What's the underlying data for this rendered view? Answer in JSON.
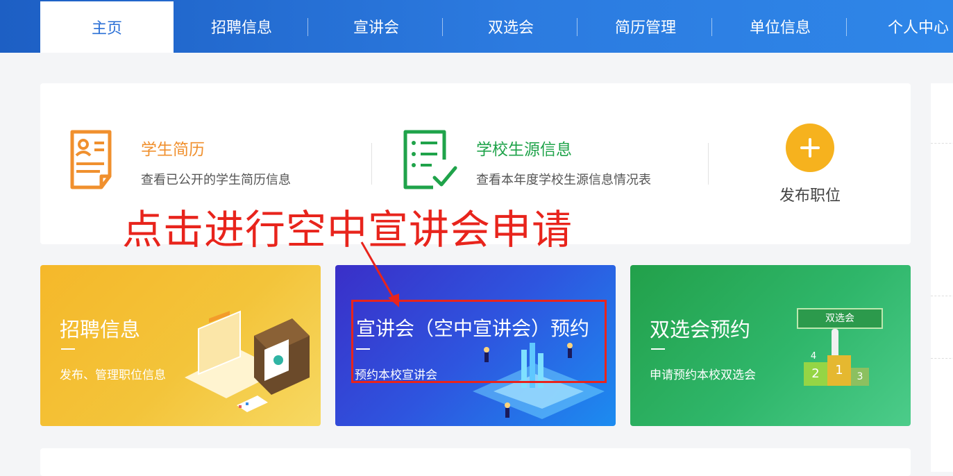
{
  "nav": {
    "tabs": [
      {
        "label": "主页",
        "active": true
      },
      {
        "label": "招聘信息",
        "active": false
      },
      {
        "label": "宣讲会",
        "active": false
      },
      {
        "label": "双选会",
        "active": false
      },
      {
        "label": "简历管理",
        "active": false
      },
      {
        "label": "单位信息",
        "active": false
      },
      {
        "label": "个人中心",
        "active": false
      }
    ]
  },
  "quick": {
    "resume": {
      "title": "学生简历",
      "desc": "查看已公开的学生简历信息",
      "icon": "resume-icon",
      "color": "#f0902e"
    },
    "source": {
      "title": "学校生源信息",
      "desc": "查看本年度学校生源信息情况表",
      "icon": "checklist-icon",
      "color": "#1fa34a"
    },
    "publish": {
      "label": "发布职位",
      "icon": "plus-icon",
      "color": "#f6b21e"
    }
  },
  "annotation": {
    "text": "点击进行空中宣讲会申请",
    "color": "#e8241c"
  },
  "promos": {
    "recruit": {
      "title": "招聘信息",
      "sub": "发布、管理职位信息"
    },
    "talk": {
      "title": "宣讲会（空中宣讲会）预约",
      "sub": "预约本校宣讲会"
    },
    "fair": {
      "title": "双选会预约",
      "sub": "申请预约本校双选会",
      "badge": "双选会",
      "podium": [
        "2",
        "1",
        "3",
        "4"
      ]
    }
  }
}
